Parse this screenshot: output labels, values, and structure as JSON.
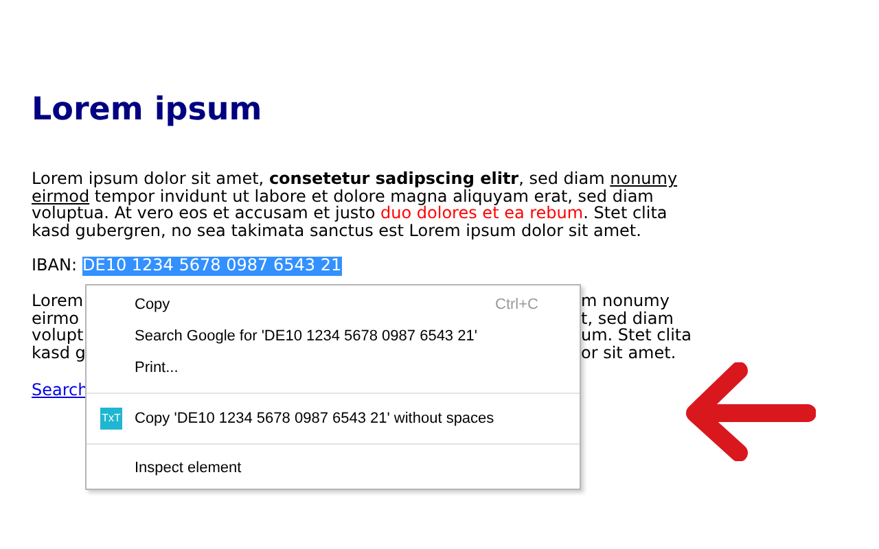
{
  "heading": "Lorem ipsum",
  "paragraph": [
    {
      "kind": "plain",
      "text": "Lorem ipsum dolor sit amet, "
    },
    {
      "kind": "bold",
      "text": "consetetur sadipscing elitr"
    },
    {
      "kind": "plain",
      "text": ", sed diam "
    },
    {
      "kind": "link",
      "text": "nonumy eirmod"
    },
    {
      "kind": "plain",
      "text": " tempor invidunt ut labore et dolore magna aliquyam erat, sed diam voluptua. At vero eos et accusam et justo "
    },
    {
      "kind": "red",
      "text": "duo dolores et ea rebum"
    },
    {
      "kind": "plain",
      "text": ". Stet clita kasd gubergren, no sea takimata sanctus est Lorem ipsum dolor sit amet."
    }
  ],
  "iban": {
    "label": "IBAN:",
    "value": "DE10 1234 5678 0987 6543 21",
    "selected": true
  },
  "covered_paragraph": [
    {
      "left": "Lorem",
      "right": "m nonumy"
    },
    {
      "left": "eirmo",
      "right": "t, sed diam"
    },
    {
      "left": "volupt",
      "right": "um. Stet clita"
    },
    {
      "left": "kasd g",
      "right": "or sit amet."
    }
  ],
  "link": "Search",
  "context_menu": [
    {
      "kind": "item",
      "label": "Copy",
      "shortcut": "Ctrl+C"
    },
    {
      "kind": "item",
      "label": "Search Google for 'DE10 1234 5678 0987 6543 21'"
    },
    {
      "kind": "item",
      "label": "Print..."
    },
    {
      "kind": "separator"
    },
    {
      "kind": "extension",
      "label": "Copy 'DE10 1234 5678 0987 6543 21' without spaces",
      "icon_text": "TxT"
    },
    {
      "kind": "separator"
    },
    {
      "kind": "item",
      "label": "Inspect element"
    }
  ]
}
